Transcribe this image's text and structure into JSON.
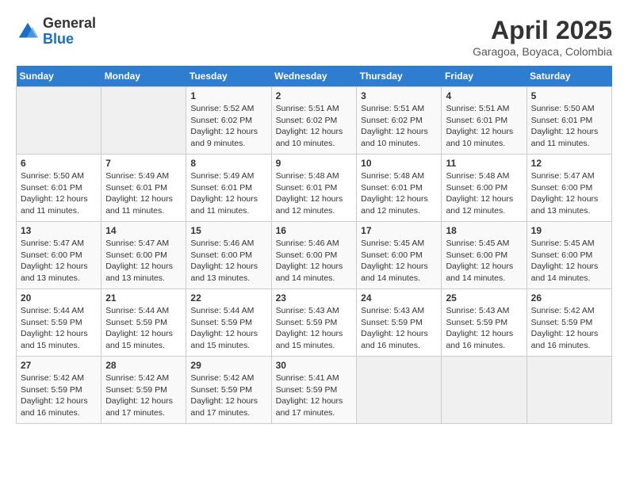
{
  "header": {
    "logo_line1": "General",
    "logo_line2": "Blue",
    "month": "April 2025",
    "location": "Garagoa, Boyaca, Colombia"
  },
  "weekdays": [
    "Sunday",
    "Monday",
    "Tuesday",
    "Wednesday",
    "Thursday",
    "Friday",
    "Saturday"
  ],
  "weeks": [
    [
      {
        "day": "",
        "info": ""
      },
      {
        "day": "",
        "info": ""
      },
      {
        "day": "1",
        "info": "Sunrise: 5:52 AM\nSunset: 6:02 PM\nDaylight: 12 hours and 9 minutes."
      },
      {
        "day": "2",
        "info": "Sunrise: 5:51 AM\nSunset: 6:02 PM\nDaylight: 12 hours and 10 minutes."
      },
      {
        "day": "3",
        "info": "Sunrise: 5:51 AM\nSunset: 6:02 PM\nDaylight: 12 hours and 10 minutes."
      },
      {
        "day": "4",
        "info": "Sunrise: 5:51 AM\nSunset: 6:01 PM\nDaylight: 12 hours and 10 minutes."
      },
      {
        "day": "5",
        "info": "Sunrise: 5:50 AM\nSunset: 6:01 PM\nDaylight: 12 hours and 11 minutes."
      }
    ],
    [
      {
        "day": "6",
        "info": "Sunrise: 5:50 AM\nSunset: 6:01 PM\nDaylight: 12 hours and 11 minutes."
      },
      {
        "day": "7",
        "info": "Sunrise: 5:49 AM\nSunset: 6:01 PM\nDaylight: 12 hours and 11 minutes."
      },
      {
        "day": "8",
        "info": "Sunrise: 5:49 AM\nSunset: 6:01 PM\nDaylight: 12 hours and 11 minutes."
      },
      {
        "day": "9",
        "info": "Sunrise: 5:48 AM\nSunset: 6:01 PM\nDaylight: 12 hours and 12 minutes."
      },
      {
        "day": "10",
        "info": "Sunrise: 5:48 AM\nSunset: 6:01 PM\nDaylight: 12 hours and 12 minutes."
      },
      {
        "day": "11",
        "info": "Sunrise: 5:48 AM\nSunset: 6:00 PM\nDaylight: 12 hours and 12 minutes."
      },
      {
        "day": "12",
        "info": "Sunrise: 5:47 AM\nSunset: 6:00 PM\nDaylight: 12 hours and 13 minutes."
      }
    ],
    [
      {
        "day": "13",
        "info": "Sunrise: 5:47 AM\nSunset: 6:00 PM\nDaylight: 12 hours and 13 minutes."
      },
      {
        "day": "14",
        "info": "Sunrise: 5:47 AM\nSunset: 6:00 PM\nDaylight: 12 hours and 13 minutes."
      },
      {
        "day": "15",
        "info": "Sunrise: 5:46 AM\nSunset: 6:00 PM\nDaylight: 12 hours and 13 minutes."
      },
      {
        "day": "16",
        "info": "Sunrise: 5:46 AM\nSunset: 6:00 PM\nDaylight: 12 hours and 14 minutes."
      },
      {
        "day": "17",
        "info": "Sunrise: 5:45 AM\nSunset: 6:00 PM\nDaylight: 12 hours and 14 minutes."
      },
      {
        "day": "18",
        "info": "Sunrise: 5:45 AM\nSunset: 6:00 PM\nDaylight: 12 hours and 14 minutes."
      },
      {
        "day": "19",
        "info": "Sunrise: 5:45 AM\nSunset: 6:00 PM\nDaylight: 12 hours and 14 minutes."
      }
    ],
    [
      {
        "day": "20",
        "info": "Sunrise: 5:44 AM\nSunset: 5:59 PM\nDaylight: 12 hours and 15 minutes."
      },
      {
        "day": "21",
        "info": "Sunrise: 5:44 AM\nSunset: 5:59 PM\nDaylight: 12 hours and 15 minutes."
      },
      {
        "day": "22",
        "info": "Sunrise: 5:44 AM\nSunset: 5:59 PM\nDaylight: 12 hours and 15 minutes."
      },
      {
        "day": "23",
        "info": "Sunrise: 5:43 AM\nSunset: 5:59 PM\nDaylight: 12 hours and 15 minutes."
      },
      {
        "day": "24",
        "info": "Sunrise: 5:43 AM\nSunset: 5:59 PM\nDaylight: 12 hours and 16 minutes."
      },
      {
        "day": "25",
        "info": "Sunrise: 5:43 AM\nSunset: 5:59 PM\nDaylight: 12 hours and 16 minutes."
      },
      {
        "day": "26",
        "info": "Sunrise: 5:42 AM\nSunset: 5:59 PM\nDaylight: 12 hours and 16 minutes."
      }
    ],
    [
      {
        "day": "27",
        "info": "Sunrise: 5:42 AM\nSunset: 5:59 PM\nDaylight: 12 hours and 16 minutes."
      },
      {
        "day": "28",
        "info": "Sunrise: 5:42 AM\nSunset: 5:59 PM\nDaylight: 12 hours and 17 minutes."
      },
      {
        "day": "29",
        "info": "Sunrise: 5:42 AM\nSunset: 5:59 PM\nDaylight: 12 hours and 17 minutes."
      },
      {
        "day": "30",
        "info": "Sunrise: 5:41 AM\nSunset: 5:59 PM\nDaylight: 12 hours and 17 minutes."
      },
      {
        "day": "",
        "info": ""
      },
      {
        "day": "",
        "info": ""
      },
      {
        "day": "",
        "info": ""
      }
    ]
  ]
}
